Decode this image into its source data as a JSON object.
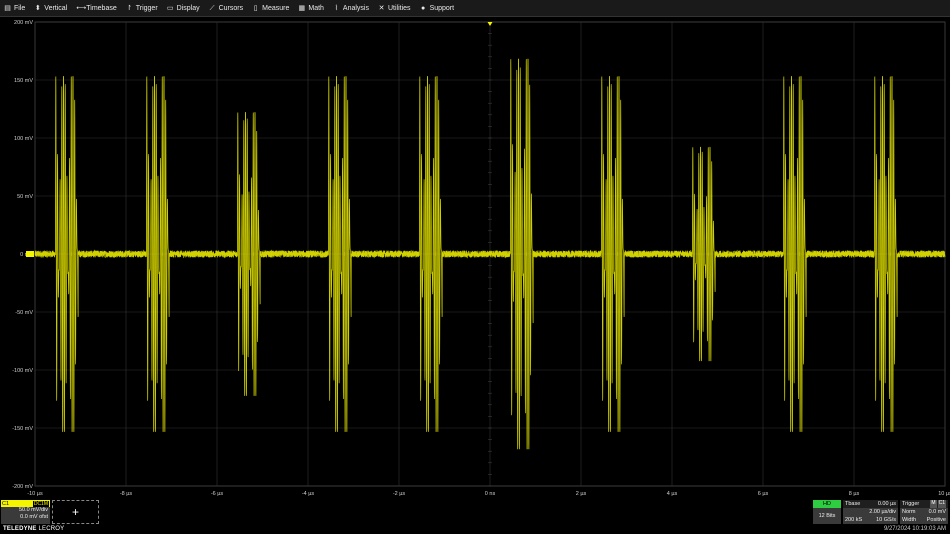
{
  "menu": [
    {
      "label": "File",
      "icon": "file-icon",
      "glyph": "▤"
    },
    {
      "label": "Vertical",
      "icon": "vertical-arrows-icon",
      "glyph": "⬍"
    },
    {
      "label": "Timebase",
      "icon": "horizontal-arrows-icon",
      "glyph": "⟷"
    },
    {
      "label": "Trigger",
      "icon": "trigger-icon",
      "glyph": "↾"
    },
    {
      "label": "Display",
      "icon": "display-icon",
      "glyph": "▭"
    },
    {
      "label": "Cursors",
      "icon": "cursor-icon",
      "glyph": "⟋"
    },
    {
      "label": "Measure",
      "icon": "measure-icon",
      "glyph": "▯"
    },
    {
      "label": "Math",
      "icon": "math-icon",
      "glyph": "▦"
    },
    {
      "label": "Analysis",
      "icon": "analysis-icon",
      "glyph": "⌇"
    },
    {
      "label": "Utilities",
      "icon": "wrench-icon",
      "glyph": "✕"
    },
    {
      "label": "Support",
      "icon": "info-icon",
      "glyph": "●"
    }
  ],
  "chart_data": {
    "type": "line",
    "trace_color": "#f5f500",
    "y_unit": "mV",
    "x_unit": "µs",
    "ylim": [
      -200,
      200
    ],
    "xlim": [
      -10,
      10
    ],
    "y_ticks": [
      "200 mV",
      "150 mV",
      "100 mV",
      "50 mV",
      "0 mV",
      "-50 mV",
      "-100 mV",
      "-150 mV",
      "-200 mV"
    ],
    "y_tick_values": [
      200,
      150,
      100,
      50,
      0,
      -50,
      -100,
      -150,
      -200
    ],
    "x_ticks": [
      "-10 µs",
      "-8 µs",
      "-6 µs",
      "-4 µs",
      "-2 µs",
      "0 ns",
      "2 µs",
      "4 µs",
      "6 µs",
      "8 µs",
      "10 µs"
    ],
    "x_tick_values": [
      -10,
      -8,
      -6,
      -4,
      -2,
      0,
      2,
      4,
      6,
      8,
      10
    ],
    "baseline_noise_mv": 3,
    "bursts": [
      {
        "start_us": -9.55,
        "end_us": -9.05,
        "amplitude_mv": 153
      },
      {
        "start_us": -7.55,
        "end_us": -7.05,
        "amplitude_mv": 153
      },
      {
        "start_us": -5.55,
        "end_us": -5.05,
        "amplitude_mv": 122
      },
      {
        "start_us": -3.55,
        "end_us": -3.05,
        "amplitude_mv": 153
      },
      {
        "start_us": -1.55,
        "end_us": -1.05,
        "amplitude_mv": 153
      },
      {
        "start_us": 0.45,
        "end_us": 0.95,
        "amplitude_mv": 168
      },
      {
        "start_us": 2.45,
        "end_us": 2.95,
        "amplitude_mv": 153
      },
      {
        "start_us": 4.45,
        "end_us": 4.95,
        "amplitude_mv": 92
      },
      {
        "start_us": 6.45,
        "end_us": 6.95,
        "amplitude_mv": 153
      },
      {
        "start_us": 8.45,
        "end_us": 8.95,
        "amplitude_mv": 153
      }
    ]
  },
  "channel": {
    "name": "C1",
    "coupling": "DC1M",
    "vdiv": "50.0 mV/div",
    "offset": "0.0 mV ofst"
  },
  "add_label": "+",
  "brand": {
    "strong": "TELEDYNE",
    "light": "LECROY"
  },
  "hd": {
    "label": "HD",
    "bits": "12 Bits"
  },
  "timebase": {
    "title": "Tbase",
    "delay": "0.00 µs",
    "tdiv": "2.00 µs/div",
    "samples": "200 kS",
    "rate": "10 GS/s"
  },
  "trigger": {
    "title": "Trigger",
    "badge1": "M",
    "badge2": "C1",
    "mode": "Norm",
    "level": "0.0 mV",
    "type": "Width",
    "slope": "Positive"
  },
  "datetime": "9/27/2024 10:19:03 AM"
}
